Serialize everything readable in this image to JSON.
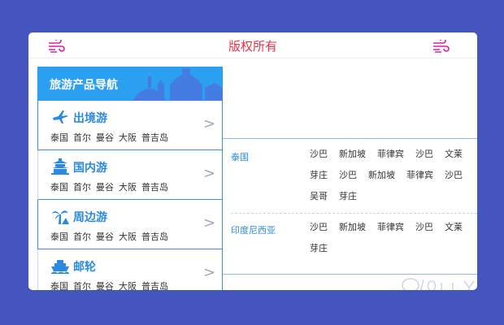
{
  "header": {
    "title": "版权所有"
  },
  "panel": {
    "title": "旅游产品导航",
    "categories": [
      {
        "name": "出境游",
        "icon": "airplane-icon",
        "cities": [
          "泰国",
          "首尔",
          "曼谷",
          "大阪",
          "普吉岛"
        ]
      },
      {
        "name": "国内游",
        "icon": "temple-icon",
        "cities": [
          "泰国",
          "首尔",
          "曼谷",
          "大阪",
          "普吉岛"
        ]
      },
      {
        "name": "周边游",
        "icon": "palm-tree-icon",
        "cities": [
          "泰国",
          "首尔",
          "曼谷",
          "大阪",
          "普吉岛"
        ]
      },
      {
        "name": "邮轮",
        "icon": "cruise-ship-icon",
        "cities": [
          "泰国",
          "首尔",
          "曼谷",
          "大阪",
          "普吉岛"
        ]
      }
    ]
  },
  "content": {
    "rows": [
      {
        "label": "泰国",
        "items": [
          "沙巴",
          "新加坡",
          "菲律宾",
          "沙巴",
          "文莱",
          "芽庄",
          "沙巴",
          "新加坡",
          "菲律宾",
          "沙巴",
          "吴哥",
          "芽庄"
        ]
      },
      {
        "label": "印度尼西亚",
        "items": [
          "沙巴",
          "新加坡",
          "菲律宾",
          "沙巴",
          "文莱",
          "芽庄"
        ]
      }
    ]
  },
  "colors": {
    "background": "#4456bd",
    "accent": "#2b9ff0",
    "title": "#e5334b",
    "icon_pink": "#e61aa8"
  },
  "icons": {
    "header": "wind-icon"
  }
}
